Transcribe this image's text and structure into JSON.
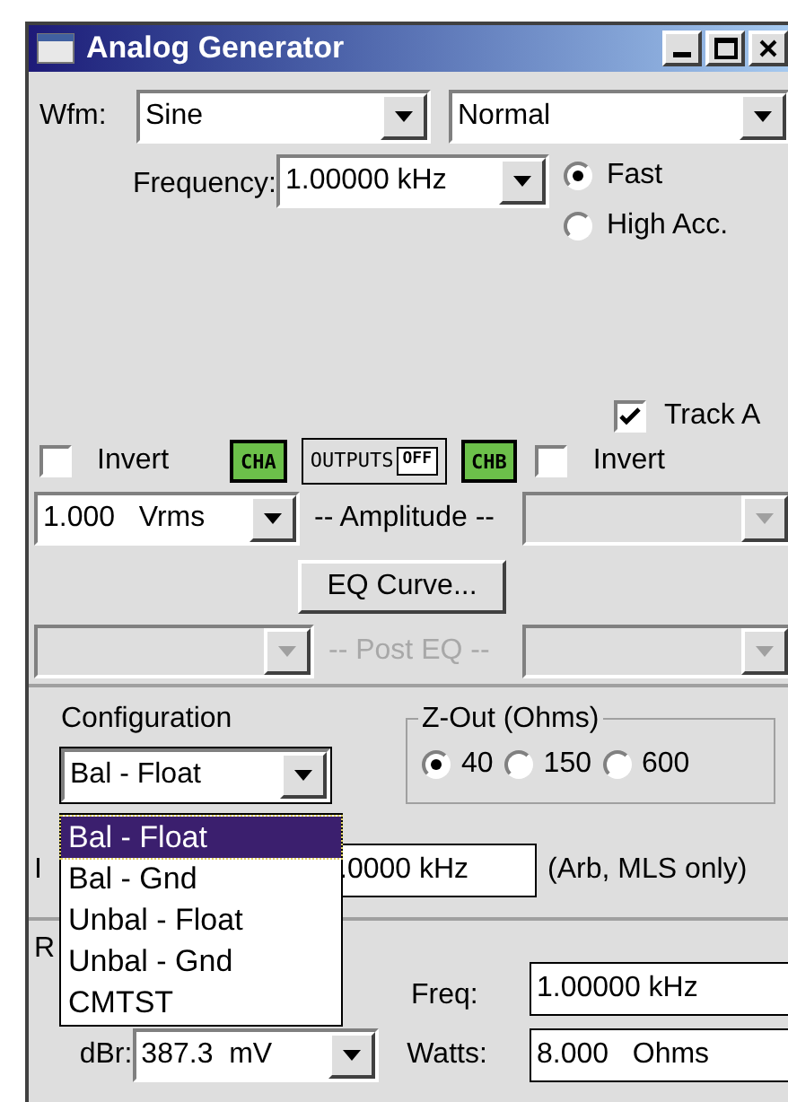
{
  "window": {
    "title": "Analog Generator"
  },
  "waveform": {
    "label": "Wfm:",
    "value": "Sine"
  },
  "mode": {
    "value": "Normal"
  },
  "frequency": {
    "label": "Frequency:",
    "value": "1.00000 kHz"
  },
  "speed_options": [
    {
      "label": "Fast",
      "selected": true
    },
    {
      "label": "High Acc.",
      "selected": false
    }
  ],
  "track": {
    "label": "Track A",
    "checked": true
  },
  "channel_a": {
    "invert_label": "Invert",
    "invert_checked": false,
    "badge": "CHA"
  },
  "outputs": {
    "label": "OUTPUTS",
    "state": "OFF"
  },
  "channel_b": {
    "invert_label": "Invert",
    "invert_checked": false,
    "badge": "CHB"
  },
  "amplitude": {
    "label": "-- Amplitude --",
    "a": {
      "value": "1.000   Vrms",
      "disabled": false
    },
    "b": {
      "disabled": true
    }
  },
  "eq_button": {
    "label": "EQ Curve..."
  },
  "post_eq": {
    "label": "-- Post EQ --",
    "disabled": true
  },
  "configuration": {
    "label": "Configuration",
    "value": "Bal - Float",
    "expanded": true,
    "options": [
      {
        "label": "Bal - Float",
        "selected": true
      },
      {
        "label": "Bal - Gnd",
        "selected": false
      },
      {
        "label": "Unbal - Float",
        "selected": false
      },
      {
        "label": "Unbal - Gnd",
        "selected": false
      },
      {
        "label": "CMTST",
        "selected": false
      }
    ]
  },
  "z_out": {
    "title": "Z-Out (Ohms)",
    "options": [
      {
        "label": "40",
        "selected": true
      },
      {
        "label": "150",
        "selected": false
      },
      {
        "label": "600",
        "selected": false
      }
    ]
  },
  "interval": {
    "label": "I",
    "value": ".0000 kHz",
    "note": "(Arb, MLS only)"
  },
  "reference": {
    "title": "R",
    "freq_label": "Freq:",
    "freq_value": "1.00000 kHz",
    "dbr_label": "dBr:",
    "dbr_value": "387.3  mV",
    "watts_label": "Watts:",
    "watts_value": "8.000   Ohms"
  }
}
